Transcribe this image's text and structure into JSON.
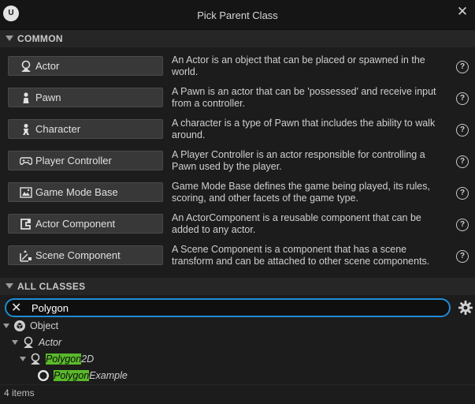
{
  "window": {
    "title": "Pick Parent Class",
    "logo_text": "U",
    "close_glyph": "✕"
  },
  "common": {
    "header": "COMMON",
    "help_glyph": "?",
    "items": [
      {
        "label": "Actor",
        "icon": "actor-icon",
        "description": "An Actor is an object that can be placed or spawned in the world."
      },
      {
        "label": "Pawn",
        "icon": "pawn-icon",
        "description": "A Pawn is an actor that can be 'possessed' and receive input from a controller."
      },
      {
        "label": "Character",
        "icon": "character-icon",
        "description": "A character is a type of Pawn that includes the ability to walk around."
      },
      {
        "label": "Player Controller",
        "icon": "gamepad-icon",
        "description": "A Player Controller is an actor responsible for controlling a Pawn used by the player."
      },
      {
        "label": "Game Mode Base",
        "icon": "game-mode-icon",
        "description": "Game Mode Base defines the game being played, its rules, scoring, and other facets of the game type."
      },
      {
        "label": "Actor Component",
        "icon": "actor-component-icon",
        "description": "An ActorComponent is a reusable component that can be added to any actor."
      },
      {
        "label": "Scene Component",
        "icon": "scene-component-icon",
        "description": "A Scene Component is a component that has a scene transform and can be attached to other scene components."
      }
    ]
  },
  "all_classes": {
    "header": "ALL CLASSES",
    "search": {
      "value": "Polygon",
      "clear_glyph": "✕"
    },
    "tree": {
      "object": {
        "label": "Object"
      },
      "actor": {
        "label": "Actor"
      },
      "polygon2d": {
        "highlight": "Polygon",
        "rest": "2D"
      },
      "polygon_example": {
        "highlight": "Polygon",
        "rest": "Example"
      }
    },
    "status": "4 items"
  },
  "colors": {
    "accent": "#1f8cd4",
    "highlight": "#5ab92a"
  }
}
